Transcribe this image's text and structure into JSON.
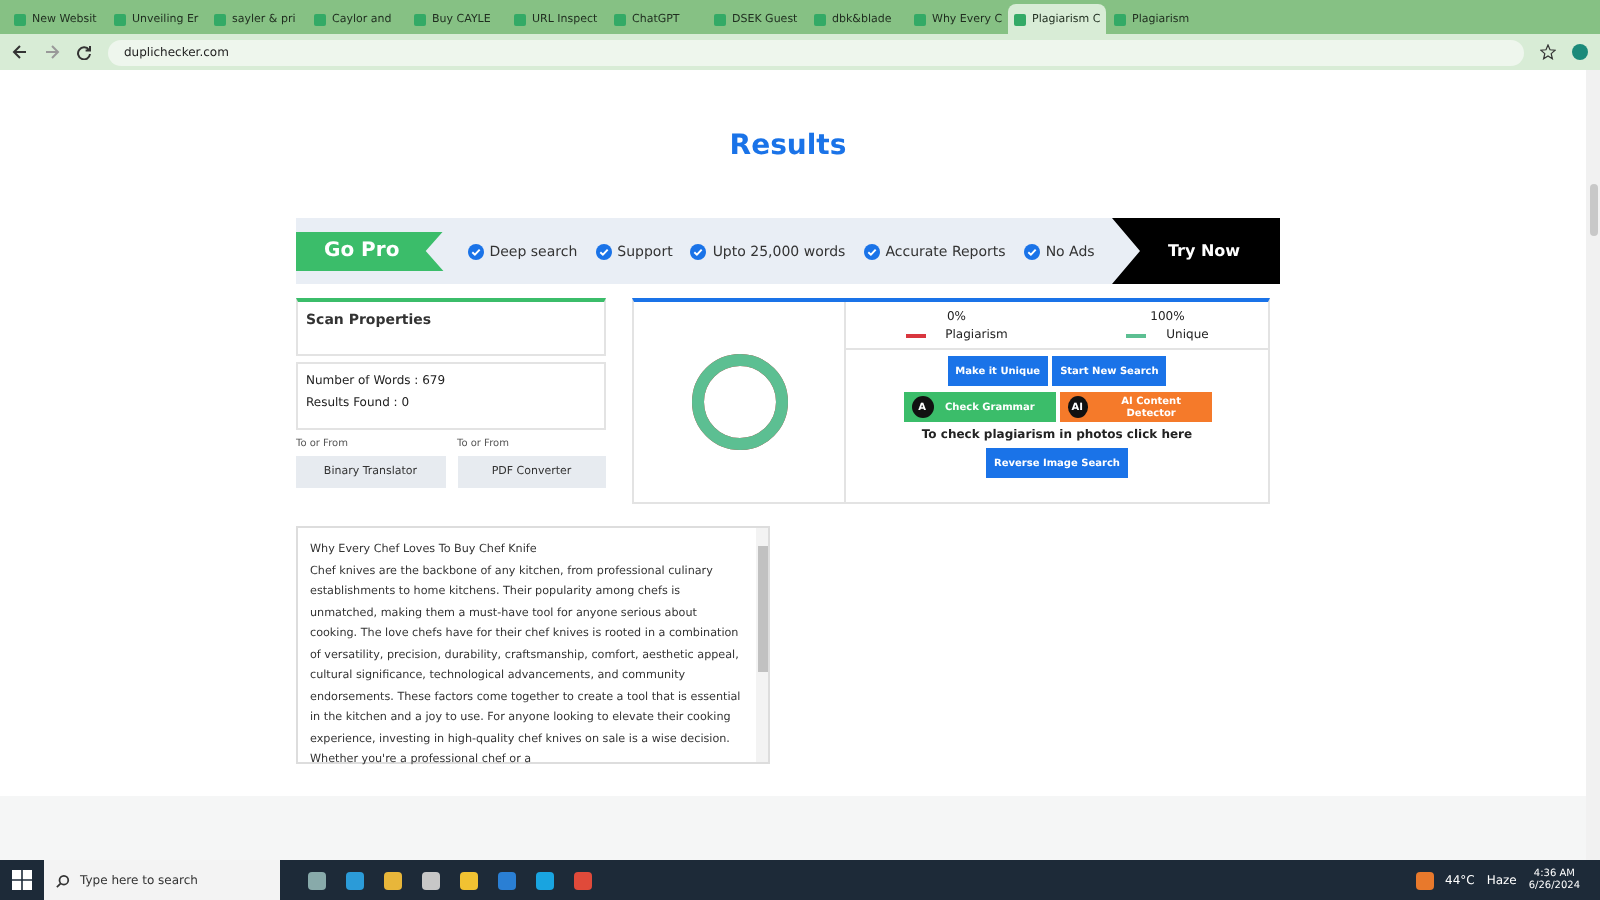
{
  "browser": {
    "tabs": [
      {
        "title": "New Websit",
        "selected": false
      },
      {
        "title": "Unveiling Er",
        "selected": false
      },
      {
        "title": "sayler & pri",
        "selected": false
      },
      {
        "title": "Caylor and",
        "selected": false
      },
      {
        "title": "Buy CAYLE",
        "selected": false
      },
      {
        "title": "URL Inspect",
        "selected": false
      },
      {
        "title": "ChatGPT",
        "selected": false
      },
      {
        "title": "DSEK Guest",
        "selected": false
      },
      {
        "title": "dbk&blade",
        "selected": false
      },
      {
        "title": "Why Every C",
        "selected": false
      },
      {
        "title": "Plagiarism C",
        "selected": true
      },
      {
        "title": "Plagiarism",
        "selected": false
      }
    ],
    "url": "duplichecker.com"
  },
  "page": {
    "title": "Results",
    "promo": {
      "badge": "Go Pro",
      "features": [
        "Deep search",
        "Support",
        "Upto 25,000 words",
        "Accurate Reports",
        "No Ads"
      ],
      "cta": "Try Now"
    },
    "scan_properties": {
      "title": "Scan Properties",
      "stats": [
        "Number of Words : 679",
        "Results Found : 0"
      ]
    },
    "tools": [
      {
        "caption": "To or From",
        "button": "Binary Translator"
      },
      {
        "caption": "To or From",
        "button": "PDF Converter"
      }
    ],
    "result": {
      "level": 1,
      "legend": [
        {
          "percent": "0%",
          "label": "Plagiarism",
          "color": "#d9363e"
        },
        {
          "percent": "100%",
          "label": "Unique",
          "color": "#5cbf92"
        }
      ],
      "primary_buttons": [
        "Make it Unique",
        "Start New Search"
      ],
      "secondary_buttons": [
        {
          "label": "Check Grammar",
          "icon": "A",
          "color": "#3bbd6a"
        },
        {
          "label": "AI Content Detector",
          "icon": "AI",
          "color": "#f57a2a"
        }
      ],
      "photo_text": "To check plagiarism in photos click here",
      "photo_button": "Reverse Image Search"
    },
    "text_title": "Why Every Chef Loves To Buy Chef Knife",
    "text_body": "Chef knives are the backbone of any kitchen, from professional culinary establishments to home kitchens. Their popularity among chefs is unmatched, making them a must-have tool for anyone serious about cooking. The love chefs have for their chef knives is rooted in a combination of versatility, precision, durability, craftsmanship, comfort, aesthetic appeal, cultural significance, technological advancements, and community endorsements. These factors come together to create a tool that is essential in the kitchen and a joy to use. For anyone looking to elevate their cooking experience, investing in high-quality chef knives on sale is a wise decision. Whether you're a professional chef or a"
  },
  "taskbar": {
    "search_placeholder": "Type here to search",
    "weather": "44°C",
    "condition": "Haze",
    "time": "4:36 AM",
    "date": "6/26/2024"
  }
}
